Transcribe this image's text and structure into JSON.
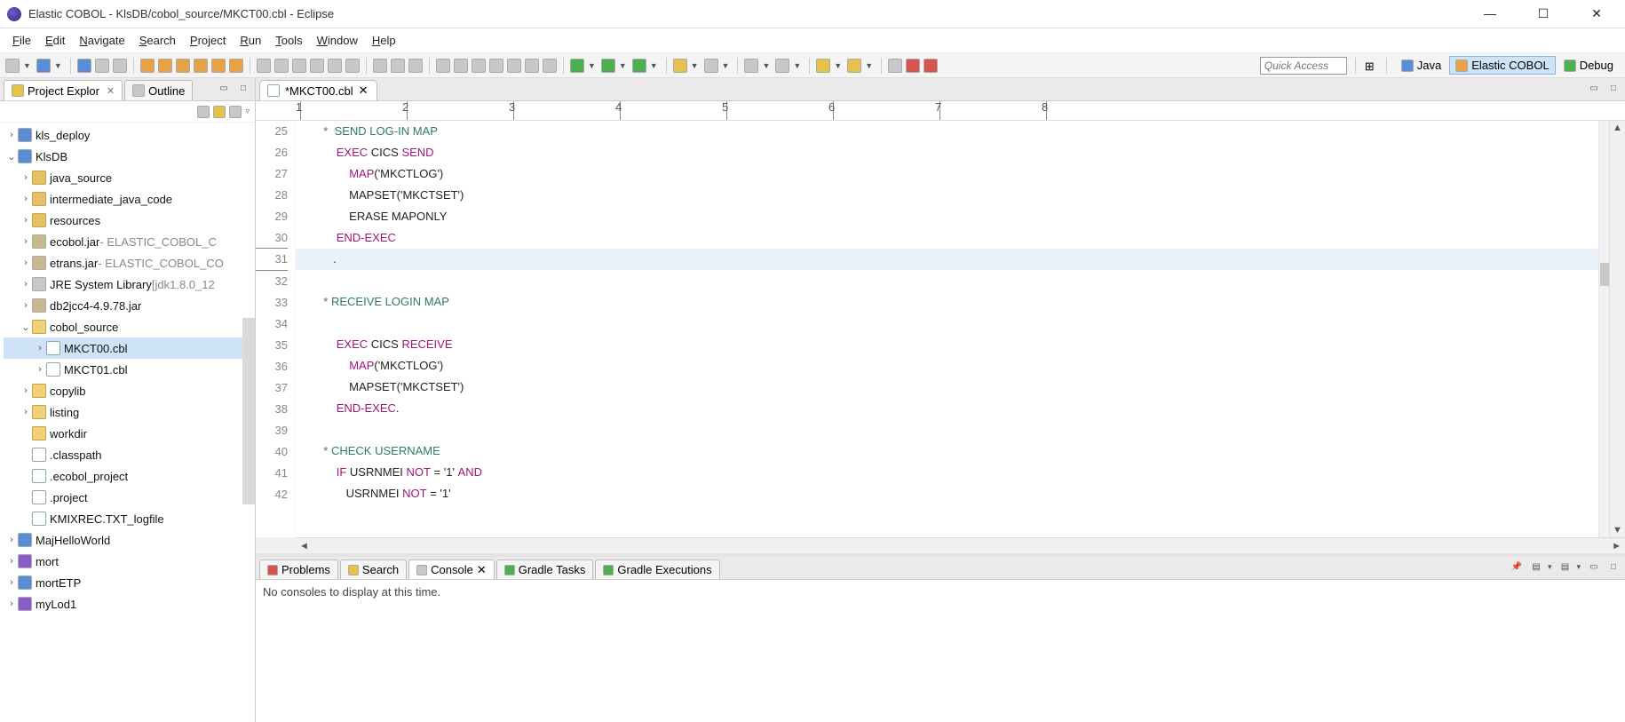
{
  "title": "Elastic COBOL - KlsDB/cobol_source/MKCT00.cbl - Eclipse",
  "menu": [
    "File",
    "Edit",
    "Navigate",
    "Search",
    "Project",
    "Run",
    "Tools",
    "Window",
    "Help"
  ],
  "quick_access_placeholder": "Quick Access",
  "perspectives": [
    {
      "label": "Java",
      "active": false
    },
    {
      "label": "Elastic COBOL",
      "active": true
    },
    {
      "label": "Debug",
      "active": false
    }
  ],
  "left_view": {
    "tabs": [
      {
        "label": "Project Explor",
        "active": true
      },
      {
        "label": "Outline",
        "active": false
      }
    ],
    "tree": [
      {
        "ind": 0,
        "twist": ">",
        "icon": "ic-blue",
        "label": "kls_deploy"
      },
      {
        "ind": 0,
        "twist": "v",
        "icon": "ic-blue",
        "label": "KlsDB"
      },
      {
        "ind": 1,
        "twist": ">",
        "icon": "ic-folder",
        "label": "java_source"
      },
      {
        "ind": 1,
        "twist": ">",
        "icon": "ic-folder",
        "label": "intermediate_java_code"
      },
      {
        "ind": 1,
        "twist": ">",
        "icon": "ic-folder",
        "label": "resources"
      },
      {
        "ind": 1,
        "twist": ">",
        "icon": "ic-jar",
        "label": "ecobol.jar",
        "suffix": " - ELASTIC_COBOL_C"
      },
      {
        "ind": 1,
        "twist": ">",
        "icon": "ic-jar",
        "label": "etrans.jar",
        "suffix": " - ELASTIC_COBOL_CO"
      },
      {
        "ind": 1,
        "twist": ">",
        "icon": "ic-gray",
        "label": "JRE System Library",
        "suffix": " [jdk1.8.0_12"
      },
      {
        "ind": 1,
        "twist": ">",
        "icon": "ic-jar",
        "label": "db2jcc4-4.9.78.jar"
      },
      {
        "ind": 1,
        "twist": "v",
        "icon": "ic-folder-open",
        "label": "cobol_source"
      },
      {
        "ind": 2,
        "twist": ">",
        "icon": "ic-file",
        "label": "MKCT00.cbl",
        "sel": true
      },
      {
        "ind": 2,
        "twist": ">",
        "icon": "ic-file",
        "label": "MKCT01.cbl"
      },
      {
        "ind": 1,
        "twist": ">",
        "icon": "ic-folder-open",
        "label": "copylib"
      },
      {
        "ind": 1,
        "twist": ">",
        "icon": "ic-folder-open",
        "label": "listing"
      },
      {
        "ind": 1,
        "twist": "",
        "icon": "ic-folder-open",
        "label": "workdir"
      },
      {
        "ind": 1,
        "twist": "",
        "icon": "ic-file",
        "label": ".classpath"
      },
      {
        "ind": 1,
        "twist": "",
        "icon": "ic-file",
        "label": ".ecobol_project"
      },
      {
        "ind": 1,
        "twist": "",
        "icon": "ic-file",
        "label": ".project"
      },
      {
        "ind": 1,
        "twist": "",
        "icon": "ic-file",
        "label": "KMIXREC.TXT_logfile"
      },
      {
        "ind": 0,
        "twist": ">",
        "icon": "ic-blue",
        "label": "MajHelloWorld"
      },
      {
        "ind": 0,
        "twist": ">",
        "icon": "ic-purple",
        "label": "mort"
      },
      {
        "ind": 0,
        "twist": ">",
        "icon": "ic-blue",
        "label": "mortETP"
      },
      {
        "ind": 0,
        "twist": ">",
        "icon": "ic-purple",
        "label": "myLod1"
      }
    ]
  },
  "editor": {
    "tab_label": "*MKCT00.cbl",
    "ruler": [
      1,
      2,
      3,
      4,
      5,
      6,
      7,
      8
    ],
    "first_line": 25,
    "current_line": 31,
    "lines": [
      {
        "n": 25,
        "seg": [
          {
            "t": "       *  ",
            "c": "c-comment"
          },
          {
            "t": "SEND LOG-IN MAP",
            "c": "c-comment"
          }
        ]
      },
      {
        "n": 26,
        "seg": [
          {
            "t": "           ",
            "c": ""
          },
          {
            "t": "EXEC",
            "c": "c-kw"
          },
          {
            "t": " CICS ",
            "c": "c-txt"
          },
          {
            "t": "SEND",
            "c": "c-kw"
          }
        ]
      },
      {
        "n": 27,
        "seg": [
          {
            "t": "               ",
            "c": ""
          },
          {
            "t": "MAP",
            "c": "c-kw"
          },
          {
            "t": "('MKCTLOG')",
            "c": "c-txt"
          }
        ]
      },
      {
        "n": 28,
        "seg": [
          {
            "t": "               MAPSET('MKCTSET')",
            "c": "c-txt"
          }
        ]
      },
      {
        "n": 29,
        "seg": [
          {
            "t": "               ERASE MAPONLY",
            "c": "c-txt"
          }
        ]
      },
      {
        "n": 30,
        "seg": [
          {
            "t": "           ",
            "c": ""
          },
          {
            "t": "END-EXEC",
            "c": "c-kw"
          }
        ]
      },
      {
        "n": 31,
        "seg": [
          {
            "t": "          .",
            "c": "c-txt"
          }
        ]
      },
      {
        "n": 32,
        "seg": [
          {
            "t": "",
            "c": ""
          }
        ]
      },
      {
        "n": 33,
        "seg": [
          {
            "t": "       * ",
            "c": "c-comment"
          },
          {
            "t": "RECEIVE LOGIN MAP",
            "c": "c-comment"
          }
        ]
      },
      {
        "n": 34,
        "seg": [
          {
            "t": "",
            "c": ""
          }
        ]
      },
      {
        "n": 35,
        "seg": [
          {
            "t": "           ",
            "c": ""
          },
          {
            "t": "EXEC",
            "c": "c-kw"
          },
          {
            "t": " CICS ",
            "c": "c-txt"
          },
          {
            "t": "RECEIVE",
            "c": "c-kw"
          }
        ]
      },
      {
        "n": 36,
        "seg": [
          {
            "t": "               ",
            "c": ""
          },
          {
            "t": "MAP",
            "c": "c-kw"
          },
          {
            "t": "('MKCTLOG')",
            "c": "c-txt"
          }
        ]
      },
      {
        "n": 37,
        "seg": [
          {
            "t": "               MAPSET('MKCTSET')",
            "c": "c-txt"
          }
        ]
      },
      {
        "n": 38,
        "seg": [
          {
            "t": "           ",
            "c": ""
          },
          {
            "t": "END-EXEC",
            "c": "c-kw"
          },
          {
            "t": ".",
            "c": "c-txt"
          }
        ]
      },
      {
        "n": 39,
        "seg": [
          {
            "t": "",
            "c": ""
          }
        ]
      },
      {
        "n": 40,
        "seg": [
          {
            "t": "       * ",
            "c": "c-comment"
          },
          {
            "t": "CHECK USERNAME",
            "c": "c-comment"
          }
        ]
      },
      {
        "n": 41,
        "seg": [
          {
            "t": "           ",
            "c": ""
          },
          {
            "t": "IF",
            "c": "c-kw"
          },
          {
            "t": " USRNMEI ",
            "c": "c-txt"
          },
          {
            "t": "NOT",
            "c": "c-kw"
          },
          {
            "t": " = '1' ",
            "c": "c-txt"
          },
          {
            "t": "AND",
            "c": "c-kw"
          }
        ]
      },
      {
        "n": 42,
        "seg": [
          {
            "t": "              USRNMEI ",
            "c": "c-txt"
          },
          {
            "t": "NOT",
            "c": "c-kw"
          },
          {
            "t": " = '1'",
            "c": "c-txt"
          }
        ]
      }
    ]
  },
  "bottom": {
    "tabs": [
      {
        "label": "Problems",
        "icon": "ic-red",
        "active": false
      },
      {
        "label": "Search",
        "icon": "ic-yel",
        "active": false
      },
      {
        "label": "Console",
        "icon": "ic-gray",
        "active": true
      },
      {
        "label": "Gradle Tasks",
        "icon": "ic-green",
        "active": false
      },
      {
        "label": "Gradle Executions",
        "icon": "ic-green",
        "active": false
      }
    ],
    "console_msg": "No consoles to display at this time."
  }
}
